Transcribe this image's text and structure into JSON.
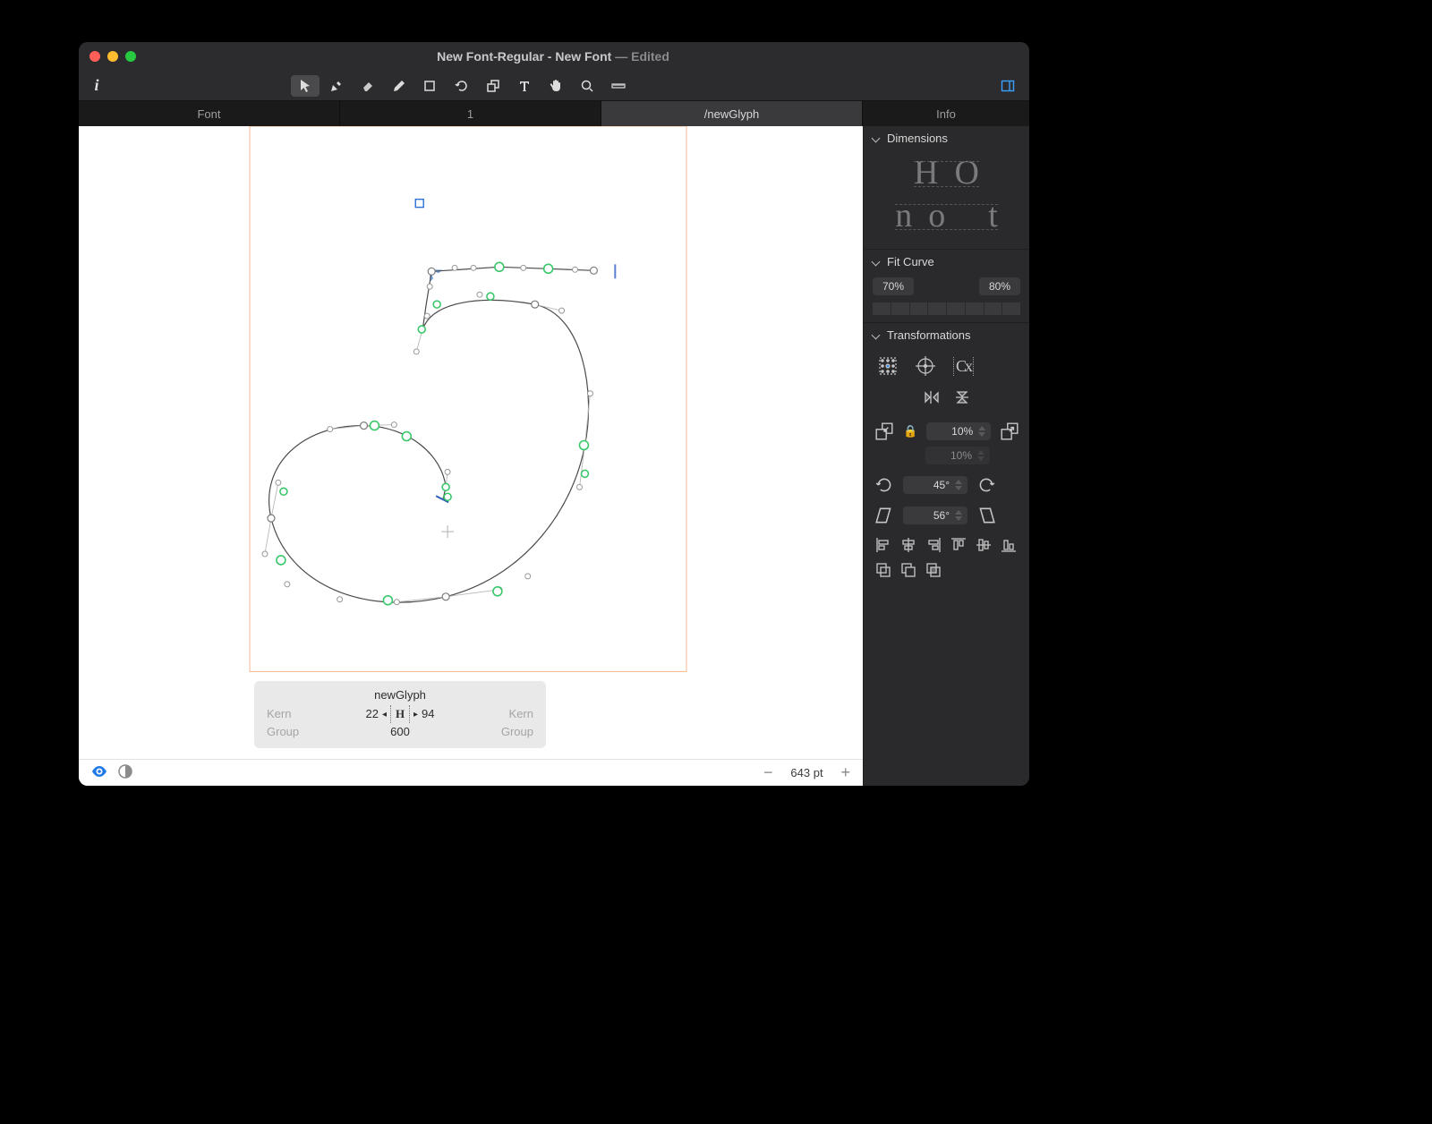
{
  "window": {
    "title_primary": "New Font-Regular - New Font",
    "title_suffix": "— Edited"
  },
  "tabs": {
    "items": [
      "Font",
      "1",
      "/newGlyph"
    ],
    "info": "Info",
    "active_index": 2
  },
  "metrics": {
    "glyph_name": "newGlyph",
    "left_kern_label": "Kern",
    "right_kern_label": "Kern",
    "left_group_label": "Group",
    "right_group_label": "Group",
    "lsb": "22",
    "rsb": "94",
    "width": "600"
  },
  "statusbar": {
    "zoom": "643 pt"
  },
  "palette": {
    "dimensions": {
      "title": "Dimensions"
    },
    "fitcurve": {
      "title": "Fit Curve",
      "low": "70%",
      "high": "80%"
    },
    "transform": {
      "title": "Transformations",
      "scale1": "10%",
      "scale2": "10%",
      "rotate": "45°",
      "slant": "56°"
    }
  }
}
